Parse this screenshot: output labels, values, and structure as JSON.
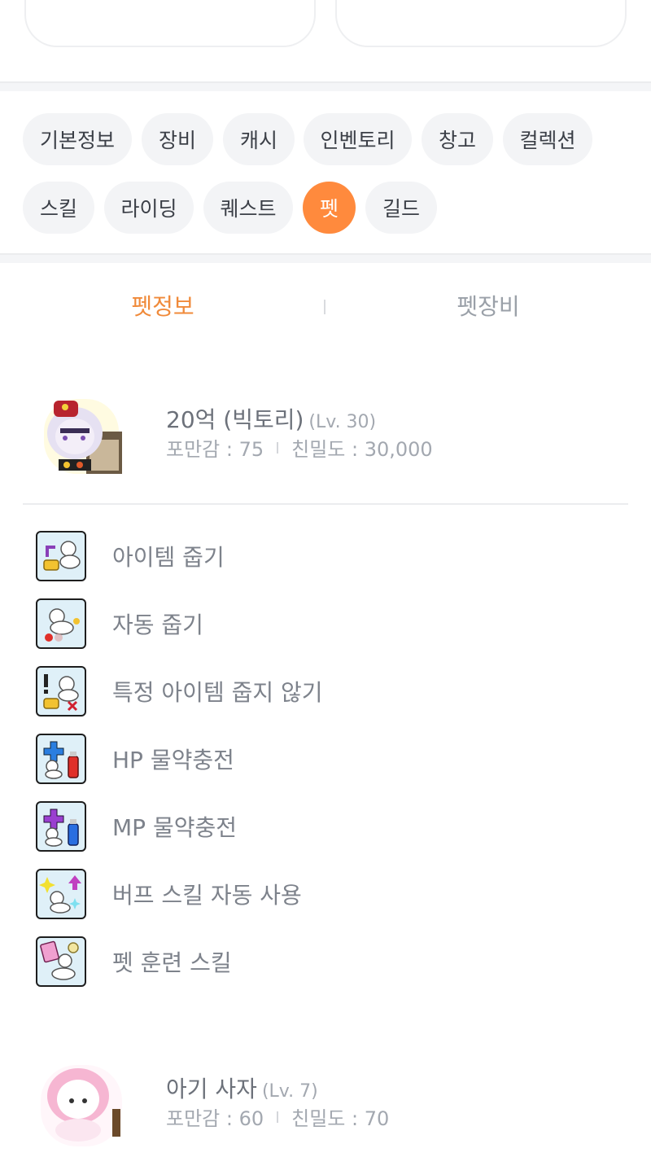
{
  "tabs": [
    {
      "label": "기본정보",
      "active": false
    },
    {
      "label": "장비",
      "active": false
    },
    {
      "label": "캐시",
      "active": false
    },
    {
      "label": "인벤토리",
      "active": false
    },
    {
      "label": "창고",
      "active": false
    },
    {
      "label": "컬렉션",
      "active": false
    },
    {
      "label": "스킬",
      "active": false
    },
    {
      "label": "라이딩",
      "active": false
    },
    {
      "label": "퀘스트",
      "active": false
    },
    {
      "label": "펫",
      "active": true
    },
    {
      "label": "길드",
      "active": false
    }
  ],
  "subtabs": [
    {
      "label": "펫정보",
      "active": true
    },
    {
      "label": "펫장비",
      "active": false
    }
  ],
  "pets": [
    {
      "name": "20억 (빅토리)",
      "level": "(Lv. 30)",
      "fullness": "포만감 : 75",
      "intimacy": "친밀도 : 30,000",
      "image_icon": "victory-pet-icon",
      "skills": [
        {
          "label": "아이템 줍기",
          "icon": "item-pickup-icon"
        },
        {
          "label": "자동 줍기",
          "icon": "auto-pickup-icon"
        },
        {
          "label": "특정 아이템 줍지 않기",
          "icon": "ignore-item-icon"
        },
        {
          "label": "HP 물약충전",
          "icon": "hp-potion-icon"
        },
        {
          "label": "MP 물약충전",
          "icon": "mp-potion-icon"
        },
        {
          "label": "버프 스킬 자동 사용",
          "icon": "auto-buff-icon"
        },
        {
          "label": "펫 훈련 스킬",
          "icon": "pet-training-icon"
        }
      ]
    },
    {
      "name": "아기 사자",
      "level": "(Lv. 7)",
      "fullness": "포만감 : 60",
      "intimacy": "친밀도 : 70",
      "image_icon": "baby-lion-pet-icon"
    }
  ],
  "colors": {
    "accent": "#ff8a3d",
    "accent_text": "#f08a3a",
    "chip_bg": "#f3f4f6"
  }
}
